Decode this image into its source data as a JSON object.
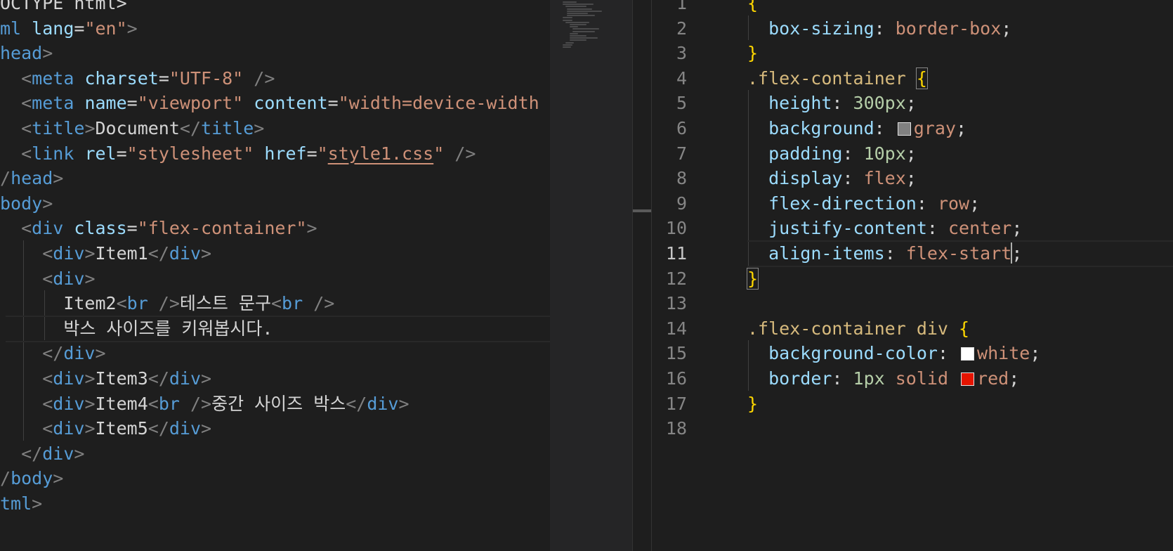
{
  "left_editor": {
    "lines": [
      {
        "tokens": [
          {
            "t": "OCTYPE html>",
            "c": "txt"
          }
        ]
      },
      {
        "tokens": [
          {
            "t": "ml",
            "c": "tag"
          },
          {
            "t": " lang",
            "c": "attr"
          },
          {
            "t": "=",
            "c": "punc"
          },
          {
            "t": "\"en\"",
            "c": "str"
          },
          {
            "t": ">",
            "c": "bracket"
          }
        ]
      },
      {
        "tokens": [
          {
            "t": "head",
            "c": "tag"
          },
          {
            "t": ">",
            "c": "bracket"
          }
        ]
      },
      {
        "tokens": [
          {
            "t": "  ",
            "c": "txt"
          },
          {
            "t": "<",
            "c": "bracket"
          },
          {
            "t": "meta",
            "c": "tag"
          },
          {
            "t": " charset",
            "c": "attr"
          },
          {
            "t": "=",
            "c": "punc"
          },
          {
            "t": "\"UTF-8\"",
            "c": "str"
          },
          {
            "t": " />",
            "c": "bracket"
          }
        ]
      },
      {
        "tokens": [
          {
            "t": "  ",
            "c": "txt"
          },
          {
            "t": "<",
            "c": "bracket"
          },
          {
            "t": "meta",
            "c": "tag"
          },
          {
            "t": " name",
            "c": "attr"
          },
          {
            "t": "=",
            "c": "punc"
          },
          {
            "t": "\"viewport\"",
            "c": "str"
          },
          {
            "t": " content",
            "c": "attr"
          },
          {
            "t": "=",
            "c": "punc"
          },
          {
            "t": "\"width=device-width",
            "c": "str"
          }
        ]
      },
      {
        "tokens": [
          {
            "t": "  ",
            "c": "txt"
          },
          {
            "t": "<",
            "c": "bracket"
          },
          {
            "t": "title",
            "c": "tag"
          },
          {
            "t": ">",
            "c": "bracket"
          },
          {
            "t": "Document",
            "c": "txt"
          },
          {
            "t": "</",
            "c": "bracket"
          },
          {
            "t": "title",
            "c": "tag"
          },
          {
            "t": ">",
            "c": "bracket"
          }
        ]
      },
      {
        "tokens": [
          {
            "t": "  ",
            "c": "txt"
          },
          {
            "t": "<",
            "c": "bracket"
          },
          {
            "t": "link",
            "c": "tag"
          },
          {
            "t": " rel",
            "c": "attr"
          },
          {
            "t": "=",
            "c": "punc"
          },
          {
            "t": "\"stylesheet\"",
            "c": "str"
          },
          {
            "t": " href",
            "c": "attr"
          },
          {
            "t": "=",
            "c": "punc"
          },
          {
            "t": "\"",
            "c": "str"
          },
          {
            "t": "style1.css",
            "c": "link"
          },
          {
            "t": "\"",
            "c": "str"
          },
          {
            "t": " />",
            "c": "bracket"
          }
        ]
      },
      {
        "tokens": [
          {
            "t": "/",
            "c": "bracket"
          },
          {
            "t": "head",
            "c": "tag"
          },
          {
            "t": ">",
            "c": "bracket"
          }
        ]
      },
      {
        "tokens": [
          {
            "t": "body",
            "c": "tag"
          },
          {
            "t": ">",
            "c": "bracket"
          }
        ]
      },
      {
        "tokens": [
          {
            "t": "  ",
            "c": "txt"
          },
          {
            "t": "<",
            "c": "bracket"
          },
          {
            "t": "div",
            "c": "tag"
          },
          {
            "t": " class",
            "c": "attr"
          },
          {
            "t": "=",
            "c": "punc"
          },
          {
            "t": "\"flex-container\"",
            "c": "str"
          },
          {
            "t": ">",
            "c": "bracket"
          }
        ]
      },
      {
        "tokens": [
          {
            "t": "    ",
            "c": "txt"
          },
          {
            "t": "<",
            "c": "bracket"
          },
          {
            "t": "div",
            "c": "tag"
          },
          {
            "t": ">",
            "c": "bracket"
          },
          {
            "t": "Item1",
            "c": "txt"
          },
          {
            "t": "</",
            "c": "bracket"
          },
          {
            "t": "div",
            "c": "tag"
          },
          {
            "t": ">",
            "c": "bracket"
          }
        ]
      },
      {
        "tokens": [
          {
            "t": "    ",
            "c": "txt"
          },
          {
            "t": "<",
            "c": "bracket"
          },
          {
            "t": "div",
            "c": "tag"
          },
          {
            "t": ">",
            "c": "bracket"
          }
        ]
      },
      {
        "tokens": [
          {
            "t": "      ",
            "c": "txt"
          },
          {
            "t": "Item2",
            "c": "txt"
          },
          {
            "t": "<",
            "c": "bracket"
          },
          {
            "t": "br",
            "c": "tag"
          },
          {
            "t": " />",
            "c": "bracket"
          },
          {
            "t": "테스트 문구",
            "c": "txt"
          },
          {
            "t": "<",
            "c": "bracket"
          },
          {
            "t": "br",
            "c": "tag"
          },
          {
            "t": " />",
            "c": "bracket"
          }
        ]
      },
      {
        "tokens": [
          {
            "t": "      ",
            "c": "txt"
          },
          {
            "t": "박스 사이즈를 키워봅시다.",
            "c": "txt"
          }
        ]
      },
      {
        "tokens": [
          {
            "t": "    ",
            "c": "txt"
          },
          {
            "t": "</",
            "c": "bracket"
          },
          {
            "t": "div",
            "c": "tag"
          },
          {
            "t": ">",
            "c": "bracket"
          }
        ]
      },
      {
        "tokens": [
          {
            "t": "    ",
            "c": "txt"
          },
          {
            "t": "<",
            "c": "bracket"
          },
          {
            "t": "div",
            "c": "tag"
          },
          {
            "t": ">",
            "c": "bracket"
          },
          {
            "t": "Item3",
            "c": "txt"
          },
          {
            "t": "</",
            "c": "bracket"
          },
          {
            "t": "div",
            "c": "tag"
          },
          {
            "t": ">",
            "c": "bracket"
          }
        ]
      },
      {
        "tokens": [
          {
            "t": "    ",
            "c": "txt"
          },
          {
            "t": "<",
            "c": "bracket"
          },
          {
            "t": "div",
            "c": "tag"
          },
          {
            "t": ">",
            "c": "bracket"
          },
          {
            "t": "Item4",
            "c": "txt"
          },
          {
            "t": "<",
            "c": "bracket"
          },
          {
            "t": "br",
            "c": "tag"
          },
          {
            "t": " />",
            "c": "bracket"
          },
          {
            "t": "중간 사이즈 박스",
            "c": "txt"
          },
          {
            "t": "</",
            "c": "bracket"
          },
          {
            "t": "div",
            "c": "tag"
          },
          {
            "t": ">",
            "c": "bracket"
          }
        ]
      },
      {
        "tokens": [
          {
            "t": "    ",
            "c": "txt"
          },
          {
            "t": "<",
            "c": "bracket"
          },
          {
            "t": "div",
            "c": "tag"
          },
          {
            "t": ">",
            "c": "bracket"
          },
          {
            "t": "Item5",
            "c": "txt"
          },
          {
            "t": "</",
            "c": "bracket"
          },
          {
            "t": "div",
            "c": "tag"
          },
          {
            "t": ">",
            "c": "bracket"
          }
        ]
      },
      {
        "tokens": [
          {
            "t": "  ",
            "c": "txt"
          },
          {
            "t": "</",
            "c": "bracket"
          },
          {
            "t": "div",
            "c": "tag"
          },
          {
            "t": ">",
            "c": "bracket"
          }
        ]
      },
      {
        "tokens": [
          {
            "t": "/",
            "c": "bracket"
          },
          {
            "t": "body",
            "c": "tag"
          },
          {
            "t": ">",
            "c": "bracket"
          }
        ]
      },
      {
        "tokens": [
          {
            "t": "tml",
            "c": "tag"
          },
          {
            "t": ">",
            "c": "bracket"
          }
        ]
      }
    ]
  },
  "right_editor": {
    "active_line": "11",
    "lines": [
      {
        "n": "1",
        "tokens": [
          {
            "t": "{",
            "c": "brace"
          }
        ]
      },
      {
        "n": "2",
        "tokens": [
          {
            "t": "  ",
            "c": "txt"
          },
          {
            "t": "box-sizing",
            "c": "prop"
          },
          {
            "t": ": ",
            "c": "punc"
          },
          {
            "t": "border-box",
            "c": "val"
          },
          {
            "t": ";",
            "c": "punc"
          }
        ]
      },
      {
        "n": "3",
        "tokens": [
          {
            "t": "}",
            "c": "brace"
          }
        ]
      },
      {
        "n": "4",
        "tokens": [
          {
            "t": ".flex-container ",
            "c": "sel"
          },
          {
            "t": "{",
            "c": "brace brace-match"
          }
        ]
      },
      {
        "n": "5",
        "tokens": [
          {
            "t": "  ",
            "c": "txt"
          },
          {
            "t": "height",
            "c": "prop"
          },
          {
            "t": ": ",
            "c": "punc"
          },
          {
            "t": "300px",
            "c": "num"
          },
          {
            "t": ";",
            "c": "punc"
          }
        ]
      },
      {
        "n": "6",
        "tokens": [
          {
            "t": "  ",
            "c": "txt"
          },
          {
            "t": "background",
            "c": "prop"
          },
          {
            "t": ": ",
            "c": "punc"
          },
          {
            "swatch": "#808080"
          },
          {
            "t": "gray",
            "c": "val"
          },
          {
            "t": ";",
            "c": "punc"
          }
        ]
      },
      {
        "n": "7",
        "tokens": [
          {
            "t": "  ",
            "c": "txt"
          },
          {
            "t": "padding",
            "c": "prop"
          },
          {
            "t": ": ",
            "c": "punc"
          },
          {
            "t": "10px",
            "c": "num"
          },
          {
            "t": ";",
            "c": "punc"
          }
        ]
      },
      {
        "n": "8",
        "tokens": [
          {
            "t": "  ",
            "c": "txt"
          },
          {
            "t": "display",
            "c": "prop"
          },
          {
            "t": ": ",
            "c": "punc"
          },
          {
            "t": "flex",
            "c": "val"
          },
          {
            "t": ";",
            "c": "punc"
          }
        ]
      },
      {
        "n": "9",
        "tokens": [
          {
            "t": "  ",
            "c": "txt"
          },
          {
            "t": "flex-direction",
            "c": "prop"
          },
          {
            "t": ": ",
            "c": "punc"
          },
          {
            "t": "row",
            "c": "val"
          },
          {
            "t": ";",
            "c": "punc"
          }
        ]
      },
      {
        "n": "10",
        "tokens": [
          {
            "t": "  ",
            "c": "txt"
          },
          {
            "t": "justify-content",
            "c": "prop"
          },
          {
            "t": ": ",
            "c": "punc"
          },
          {
            "t": "center",
            "c": "val"
          },
          {
            "t": ";",
            "c": "punc"
          }
        ]
      },
      {
        "n": "11",
        "tokens": [
          {
            "t": "  ",
            "c": "txt"
          },
          {
            "t": "align-items",
            "c": "prop"
          },
          {
            "t": ": ",
            "c": "punc"
          },
          {
            "t": "flex-start",
            "c": "val"
          },
          {
            "cursor": true
          },
          {
            "t": ";",
            "c": "punc"
          }
        ]
      },
      {
        "n": "12",
        "tokens": [
          {
            "t": "}",
            "c": "brace brace-match"
          }
        ]
      },
      {
        "n": "13",
        "tokens": []
      },
      {
        "n": "14",
        "tokens": [
          {
            "t": ".flex-container div ",
            "c": "sel"
          },
          {
            "t": "{",
            "c": "brace"
          }
        ]
      },
      {
        "n": "15",
        "tokens": [
          {
            "t": "  ",
            "c": "txt"
          },
          {
            "t": "background-color",
            "c": "prop"
          },
          {
            "t": ": ",
            "c": "punc"
          },
          {
            "swatch": "#ffffff"
          },
          {
            "t": "white",
            "c": "val"
          },
          {
            "t": ";",
            "c": "punc"
          }
        ]
      },
      {
        "n": "16",
        "tokens": [
          {
            "t": "  ",
            "c": "txt"
          },
          {
            "t": "border",
            "c": "prop"
          },
          {
            "t": ": ",
            "c": "punc"
          },
          {
            "t": "1px",
            "c": "num"
          },
          {
            "t": " solid ",
            "c": "val"
          },
          {
            "swatch": "#e51400"
          },
          {
            "t": "red",
            "c": "val"
          },
          {
            "t": ";",
            "c": "punc"
          }
        ]
      },
      {
        "n": "17",
        "tokens": [
          {
            "t": "}",
            "c": "brace"
          }
        ]
      },
      {
        "n": "18",
        "tokens": []
      }
    ]
  }
}
